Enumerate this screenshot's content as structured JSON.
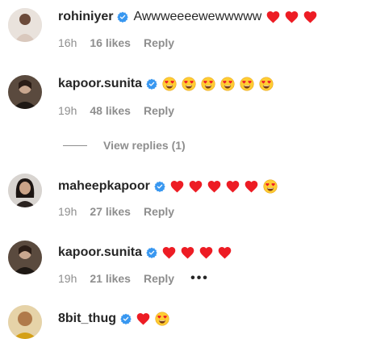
{
  "comments": [
    {
      "username": "rohiniyer",
      "text": "Awwweeeewewwwww",
      "time": "16h",
      "likes": "16 likes",
      "reply": "Reply",
      "emojis": [
        "red-heart",
        "red-heart",
        "red-heart"
      ]
    },
    {
      "username": "kapoor.sunita",
      "text": "",
      "time": "19h",
      "likes": "48 likes",
      "reply": "Reply",
      "emojis": [
        "heart-eyes",
        "heart-eyes",
        "heart-eyes",
        "heart-eyes",
        "heart-eyes",
        "heart-eyes"
      ]
    },
    {
      "username": "maheepkapoor",
      "text": "",
      "time": "19h",
      "likes": "27 likes",
      "reply": "Reply",
      "emojis": [
        "red-heart",
        "red-heart",
        "red-heart",
        "red-heart",
        "red-heart",
        "heart-eyes"
      ]
    },
    {
      "username": "kapoor.sunita",
      "text": "",
      "time": "19h",
      "likes": "21 likes",
      "reply": "Reply",
      "more": "•••",
      "emojis": [
        "red-heart",
        "red-heart",
        "red-heart",
        "red-heart"
      ]
    },
    {
      "username": "8bit_thug",
      "text": "",
      "emojis": [
        "red-heart",
        "heart-eyes"
      ]
    }
  ],
  "view_replies": {
    "label": "View replies (1)"
  },
  "colors": {
    "verified": "#3897f0",
    "heart": "#ed1c24",
    "muted": "#8e8e8e"
  }
}
